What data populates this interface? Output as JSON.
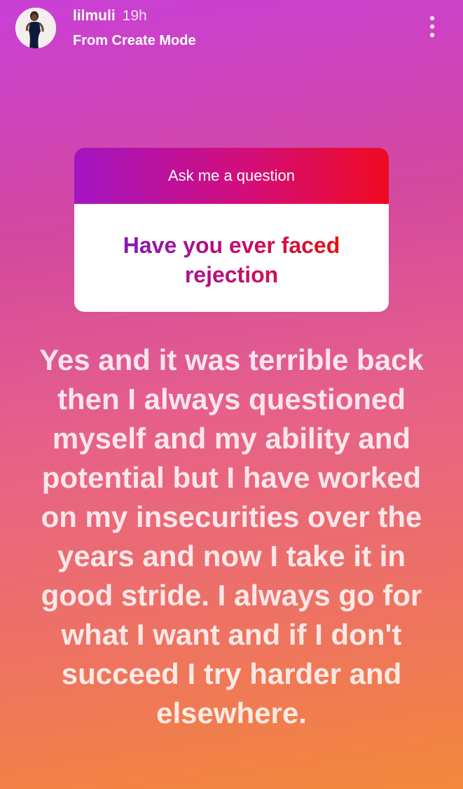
{
  "story": {
    "username": "lilmuli",
    "time_ago": "19h",
    "subtitle": "From Create Mode"
  },
  "question_sticker": {
    "header": "Ask me a question",
    "question": "Have you ever faced rejection"
  },
  "answer_text": "Yes and  it was terrible back then I always questioned myself and my ability and potential but I have worked on my insecurities over the years and now I take it in good stride. I always go for what I want and if I don't succeed I try harder and elsewhere.",
  "icons": {
    "avatar": "profile-photo",
    "more": "more-vertical-icon"
  },
  "colors": {
    "background_top": "#c93fd6",
    "background_bottom": "#f3883a",
    "sticker_header_start": "#a315c2",
    "sticker_header_end": "#ef0a22"
  }
}
